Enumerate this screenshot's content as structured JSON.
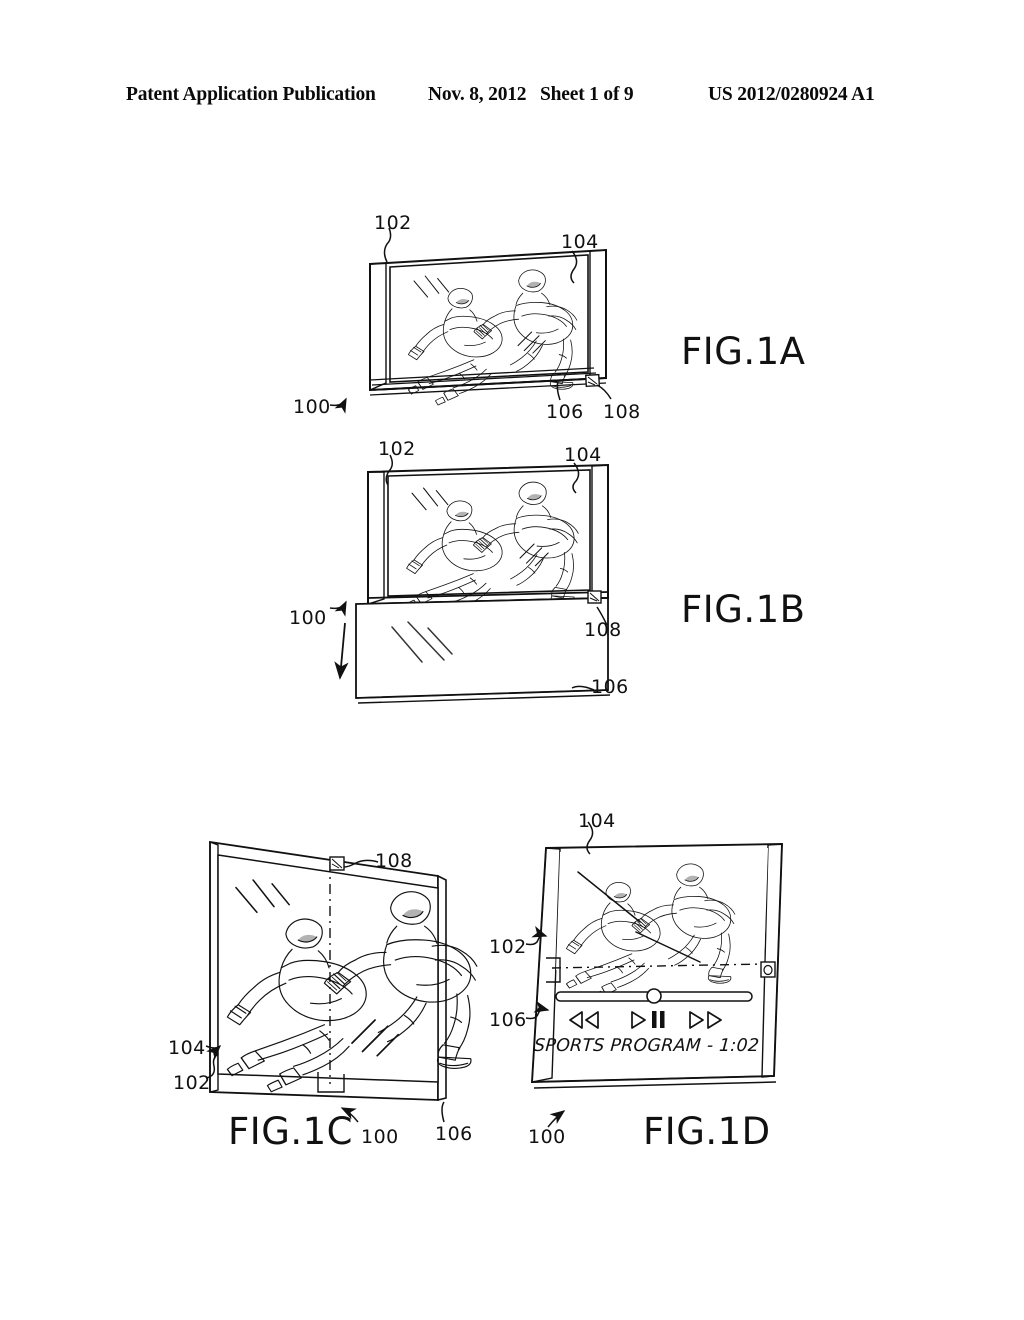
{
  "header": {
    "publication_title": "Patent Application Publication",
    "date": "Nov. 8, 2012",
    "sheet": "Sheet 1 of 9",
    "publication_number": "US 2012/0280924 A1"
  },
  "figures": [
    {
      "id": "fig-1a",
      "caption": "FIG.1A",
      "description": "Device in retracted state, perspective view, displaying sports video of two speed skaters",
      "ref_numerals": [
        {
          "label": "102",
          "meaning": "first-housing-portion"
        },
        {
          "label": "104",
          "meaning": "display-screen"
        },
        {
          "label": "100",
          "meaning": "device"
        },
        {
          "label": "106",
          "meaning": "second-housing-portion-retracted"
        },
        {
          "label": "108",
          "meaning": "control-button"
        }
      ]
    },
    {
      "id": "fig-1b",
      "caption": "FIG.1B",
      "description": "Device with second panel partially extended downward, arrow indicates extension direction",
      "ref_numerals": [
        {
          "label": "102",
          "meaning": "first-housing-portion"
        },
        {
          "label": "104",
          "meaning": "display-screen"
        },
        {
          "label": "100",
          "meaning": "device"
        },
        {
          "label": "108",
          "meaning": "control-button"
        },
        {
          "label": "106",
          "meaning": "extended-panel"
        }
      ]
    },
    {
      "id": "fig-1c",
      "caption": "FIG.1C",
      "description": "Device fully extended, front perspective view, image spanning both panels",
      "ref_numerals": [
        {
          "label": "108",
          "meaning": "control-button"
        },
        {
          "label": "104",
          "meaning": "display-screen"
        },
        {
          "label": "102",
          "meaning": "first-housing-portion"
        },
        {
          "label": "100",
          "meaning": "device"
        },
        {
          "label": "106",
          "meaning": "extended-panel"
        }
      ]
    },
    {
      "id": "fig-1d",
      "caption": "FIG.1D",
      "description": "Device extended showing video on upper panel and media playback controls on lower panel",
      "ref_numerals": [
        {
          "label": "104",
          "meaning": "display-screen"
        },
        {
          "label": "102",
          "meaning": "first-housing-portion"
        },
        {
          "label": "106",
          "meaning": "extended-panel-controls"
        },
        {
          "label": "100",
          "meaning": "device"
        }
      ]
    }
  ],
  "media_controls": {
    "program_title": "SPORTS PROGRAM - 1:02",
    "buttons": [
      {
        "name": "rewind-button",
        "glyph": "◁◁"
      },
      {
        "name": "play-button",
        "glyph": "▷"
      },
      {
        "name": "pause-button",
        "glyph": "❙❙"
      },
      {
        "name": "fast-forward-button",
        "glyph": "▷▷"
      }
    ],
    "progress_slider": {
      "name": "progress-slider",
      "knob_position_percent": 50
    }
  },
  "colors": {
    "line": "#111111",
    "background": "#ffffff"
  }
}
